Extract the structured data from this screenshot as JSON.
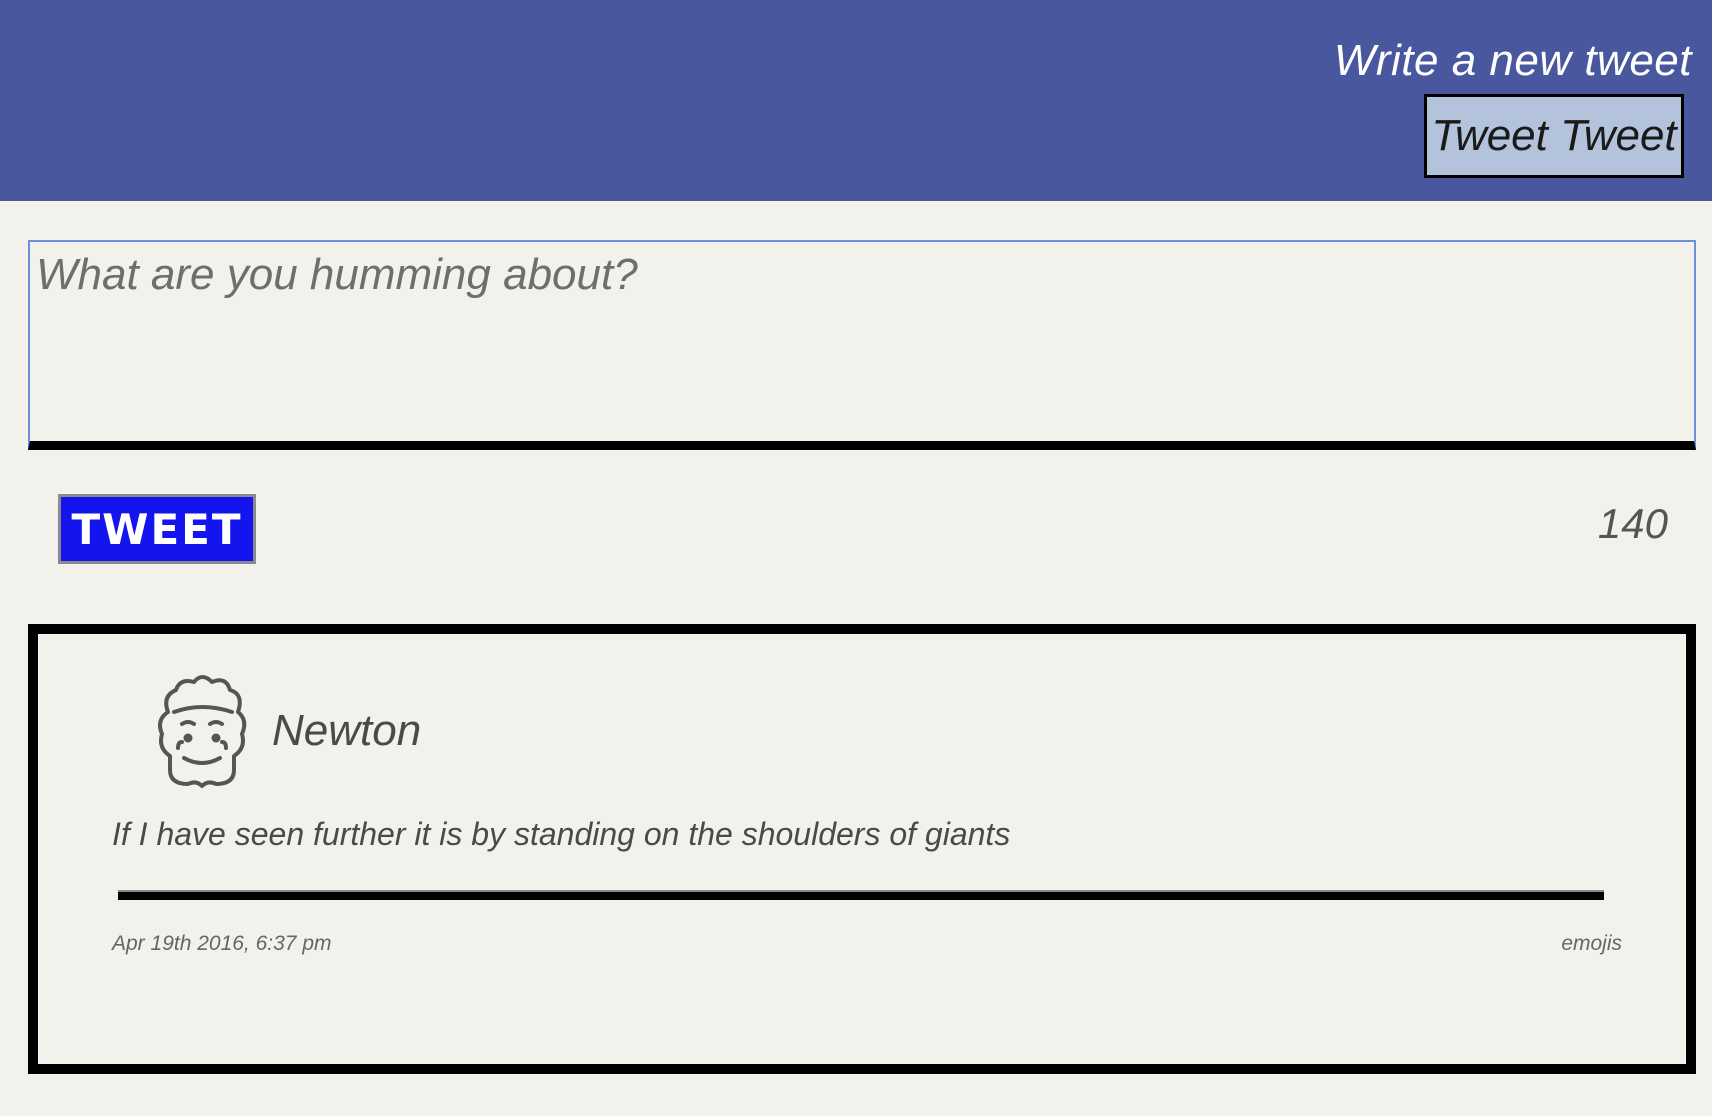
{
  "header": {
    "title": "Write a new tweet",
    "button_label": "Tweet Tweet",
    "background": "#49579e"
  },
  "compose": {
    "placeholder": "What are you humming about?",
    "value": "",
    "submit_label": "TWEET",
    "char_count": "140"
  },
  "tweets": [
    {
      "avatar_icon": "curly-hair-face-icon",
      "username": "Newton",
      "text": "If I have seen further it is by standing on the shoulders of giants",
      "timestamp": "Apr 19th 2016, 6:37 pm",
      "emojis_label": "emojis"
    }
  ],
  "colors": {
    "page_background": "#f3f1ec",
    "tweet_button": "#1414ee",
    "header_button": "#b4c3dc"
  }
}
